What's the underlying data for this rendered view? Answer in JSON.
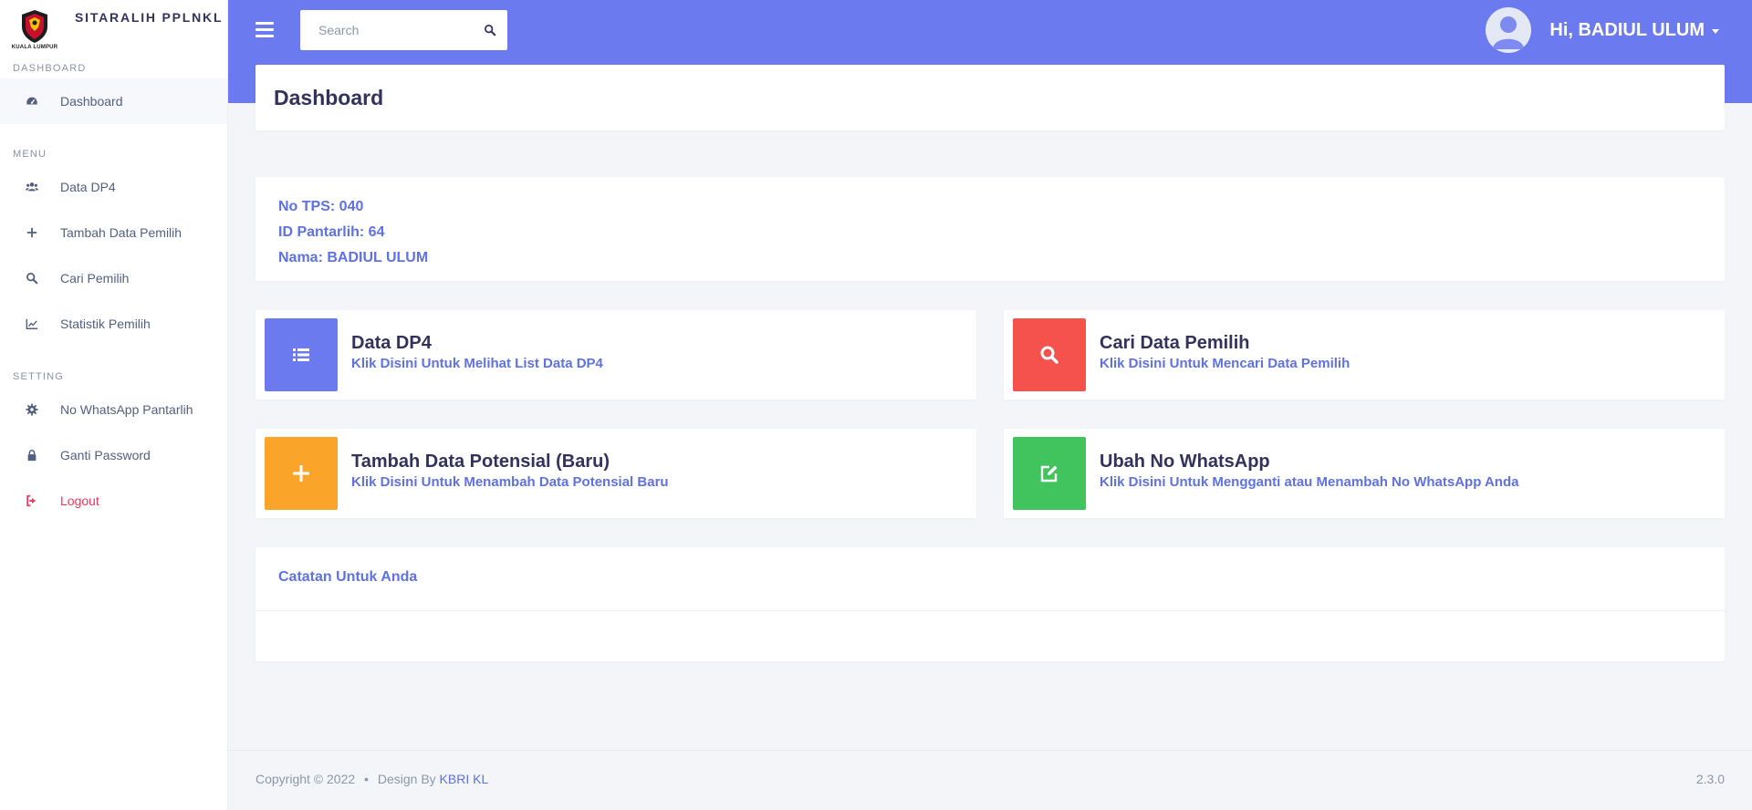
{
  "brand": {
    "name": "SITARALIH PPLNKL",
    "logo_text": "KUALA LUMPUR"
  },
  "sidebar": {
    "sections": [
      {
        "title": "DASHBOARD"
      },
      {
        "title": "MENU"
      },
      {
        "title": "SETTING"
      }
    ],
    "items": [
      {
        "label": "Dashboard",
        "icon": "dashboard-icon"
      },
      {
        "label": "Data DP4",
        "icon": "users-icon"
      },
      {
        "label": "Tambah Data Pemilih",
        "icon": "plus-icon"
      },
      {
        "label": "Cari Pemilih",
        "icon": "search-icon"
      },
      {
        "label": "Statistik Pemilih",
        "icon": "chart-line-icon"
      },
      {
        "label": "No WhatsApp Pantarlih",
        "icon": "gear-icon"
      },
      {
        "label": "Ganti Password",
        "icon": "lock-icon"
      },
      {
        "label": "Logout",
        "icon": "sign-out-icon"
      }
    ]
  },
  "topbar": {
    "search": {
      "placeholder": "Search",
      "value": ""
    },
    "user_greeting": "Hi, BADIUL ULUM"
  },
  "page": {
    "title": "Dashboard"
  },
  "info": {
    "lines": [
      "No TPS: 040",
      "ID Pantarlih: 64",
      "Nama: BADIUL ULUM"
    ]
  },
  "actions": [
    {
      "title": "Data DP4",
      "subtitle": "Klik Disini Untuk Melihat List Data DP4",
      "color": "#6b7aef",
      "icon": "list-icon"
    },
    {
      "title": "Cari Data Pemilih",
      "subtitle": "Klik Disini Untuk Mencari Data Pemilih",
      "color": "#f5524e",
      "icon": "search-icon"
    },
    {
      "title": "Tambah Data Potensial (Baru)",
      "subtitle": "Klik Disini Untuk Menambah Data Potensial Baru",
      "color": "#fba42a",
      "icon": "plus-icon"
    },
    {
      "title": "Ubah No WhatsApp",
      "subtitle": "Klik Disini Untuk Mengganti atau Menambah No WhatsApp Anda",
      "color": "#41c35e",
      "icon": "edit-icon"
    }
  ],
  "notes": {
    "title": "Catatan Untuk Anda"
  },
  "footer": {
    "copyright": "Copyright © 2022",
    "separator": "•",
    "design_by": "Design By",
    "design_link": "KBRI KL",
    "version": "2.3.0"
  },
  "colors": {
    "primary": "#6b7aef",
    "link": "#5e72e4",
    "danger": "#f5365c"
  }
}
